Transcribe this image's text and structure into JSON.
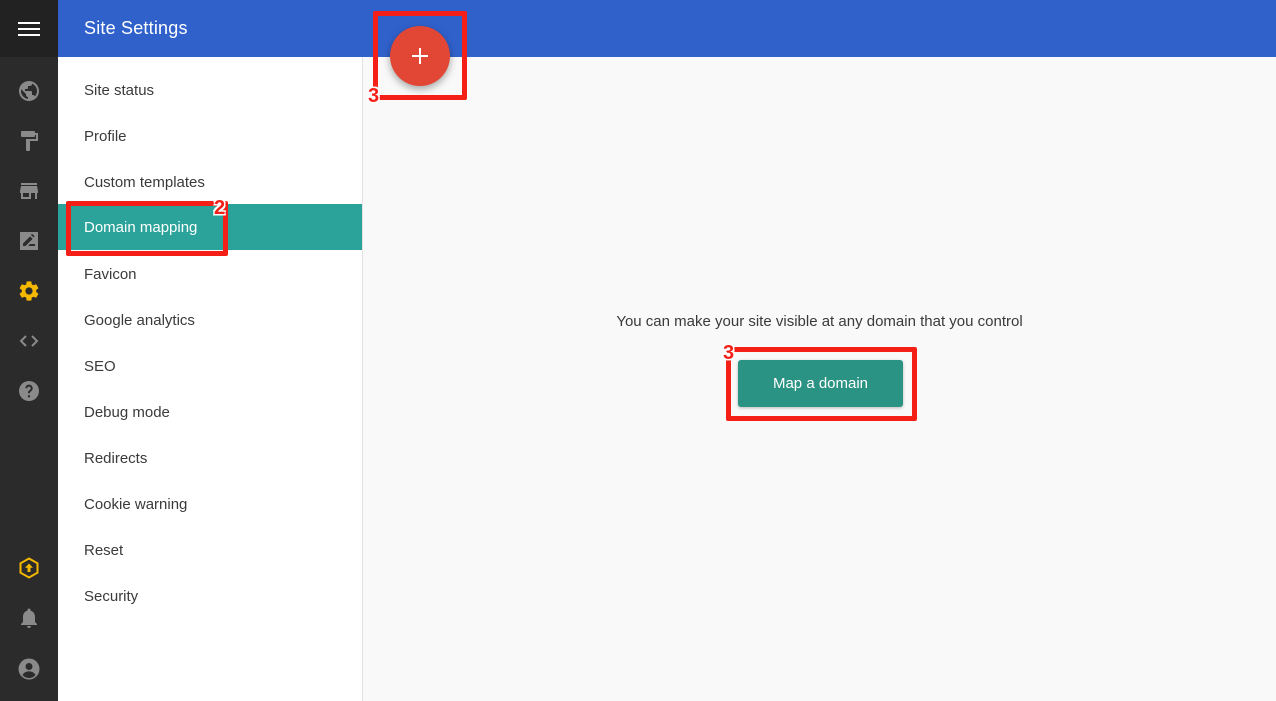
{
  "header": {
    "title": "Site Settings"
  },
  "rail": {
    "items": [
      {
        "icon": "menu-icon"
      },
      {
        "icon": "globe-icon"
      },
      {
        "icon": "paint-roller-icon"
      },
      {
        "icon": "store-icon"
      },
      {
        "icon": "edit-note-icon"
      },
      {
        "icon": "gear-icon",
        "active": true,
        "color": "#f5b800"
      },
      {
        "icon": "code-icon"
      },
      {
        "icon": "help-icon"
      },
      {
        "icon": "upgrade-icon",
        "color": "#f5b800"
      },
      {
        "icon": "bell-icon"
      },
      {
        "icon": "account-icon"
      }
    ]
  },
  "menu": {
    "items": [
      {
        "label": "Site status"
      },
      {
        "label": "Profile"
      },
      {
        "label": "Custom templates"
      },
      {
        "label": "Domain mapping",
        "active": true
      },
      {
        "label": "Favicon"
      },
      {
        "label": "Google analytics"
      },
      {
        "label": "SEO"
      },
      {
        "label": "Debug mode"
      },
      {
        "label": "Redirects"
      },
      {
        "label": "Cookie warning"
      },
      {
        "label": "Reset"
      },
      {
        "label": "Security"
      }
    ]
  },
  "main": {
    "empty_text": "You can make your site visible at any domain that you control",
    "map_button_label": "Map a domain"
  },
  "fab": {
    "icon": "plus-icon"
  },
  "annotations": [
    {
      "target": "domain-mapping",
      "number": "2"
    },
    {
      "target": "fab",
      "number": "3"
    },
    {
      "target": "map-domain-button",
      "number": "3"
    }
  ],
  "colors": {
    "header": "#3061cb",
    "rail": "#2b2b2b",
    "active_menu": "#2ba39a",
    "map_button": "#2b9384",
    "fab": "#e24634",
    "annotation": "#f41f16",
    "accent_icon": "#f5b800"
  }
}
